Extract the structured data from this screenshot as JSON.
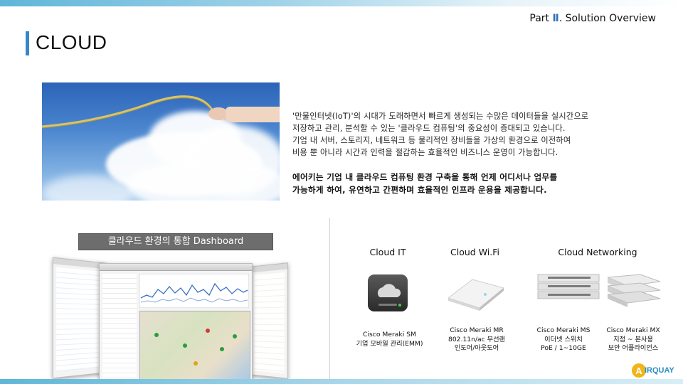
{
  "header": {
    "part_prefix": "Part ",
    "part_numeral": "Ⅱ",
    "part_suffix": ". Solution Overview",
    "title": "CLOUD"
  },
  "description": {
    "lines": [
      "'만물인터넷(IoT)'의 시대가 도래하면서 빠르게 생성되는 수많은 데이터들을 실시간으로",
      "저장하고 관리, 분석할 수 있는 '클라우드 컴퓨팅'의 중요성이 증대되고 있습니다.",
      "기업 내 서버, 스토리지, 네트워크 등 물리적인 장비들을 가상의 환경으로 이전하여",
      "비용 뿐 아니라 시간과 인력을 절감하는 효율적인 비즈니스 운영이 가능합니다."
    ],
    "highlight_lines": [
      "에어키는 기업 내 클라우드 컴퓨팅 환경 구축을 통해 언제 어디서나 업무를",
      "가능하게 하여, 유연하고 간편하며 효율적인 인프라 운용을 제공합니다."
    ]
  },
  "dashboard": {
    "label": "클라우드 환경의 통합 Dashboard"
  },
  "products": {
    "cloud_it": {
      "title": "Cloud IT",
      "caption_line1": "Cisco Meraki SM",
      "caption_line2": "기업 모바일 관리(EMM)"
    },
    "cloud_wifi": {
      "title": "Cloud Wi.Fi",
      "caption_line1": "Cisco Meraki MR",
      "caption_line2": "802.11n/ac 무선랜",
      "caption_line3": "인도어/아웃도어"
    },
    "cloud_networking": {
      "title": "Cloud Networking",
      "ms_line1": "Cisco Meraki MS",
      "ms_line2": "이더넷 스위치",
      "ms_line3": "PoE / 1~10GE",
      "mx_line1": "Cisco Meraki MX",
      "mx_line2": "지점 ~ 본사용",
      "mx_line3": "보안 어플라이언스"
    }
  },
  "logo": {
    "letter": "A",
    "text": "IRQUAY"
  },
  "colors": {
    "accent": "#3a86c8",
    "roman": "#2d6fb7",
    "label_bg": "#6d6d6d",
    "logo": "#2a8fc4",
    "logo_letter": "#f2b417"
  }
}
